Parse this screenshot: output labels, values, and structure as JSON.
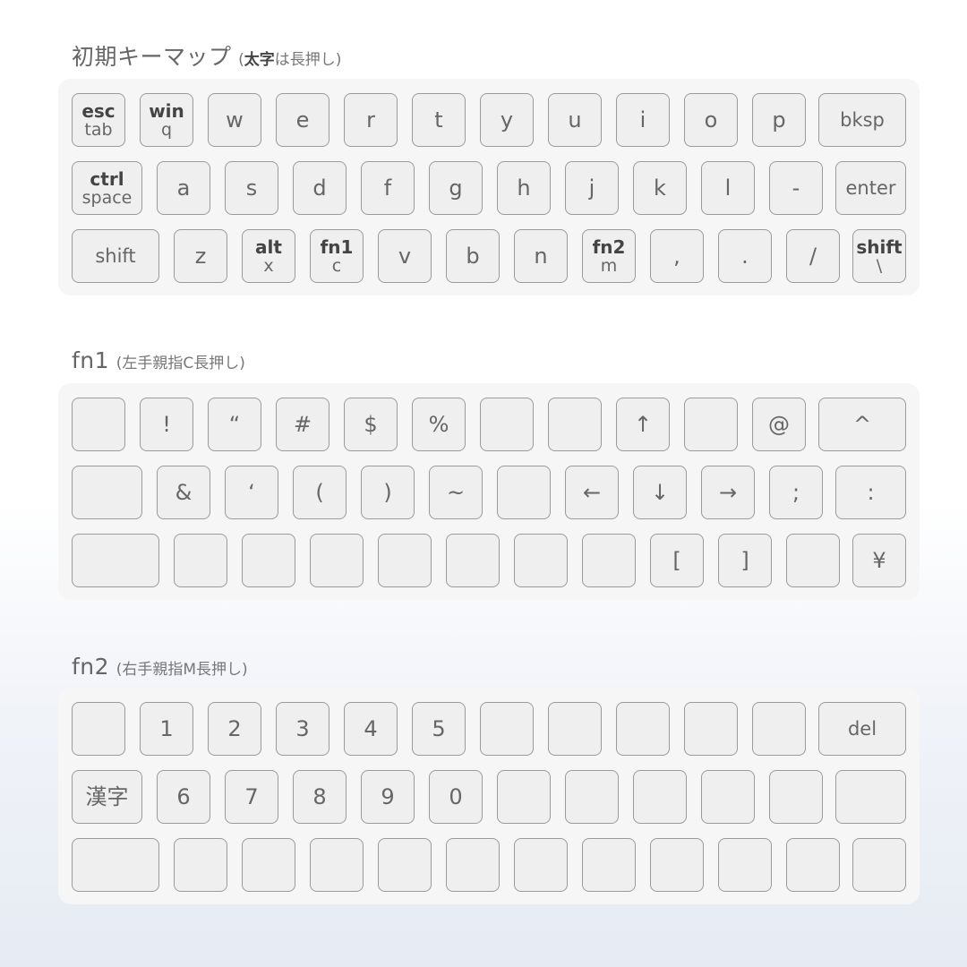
{
  "sections": [
    {
      "title": "初期キーマップ",
      "note_open": "(",
      "note_bold": "太字",
      "note_rest": "は長押し)",
      "rows": [
        [
          {
            "top": "esc",
            "bottom": "tab"
          },
          {
            "top": "win",
            "bottom": "q"
          },
          {
            "label": "w"
          },
          {
            "label": "e"
          },
          {
            "label": "r"
          },
          {
            "label": "t"
          },
          {
            "label": "y"
          },
          {
            "label": "u"
          },
          {
            "label": "i"
          },
          {
            "label": "o"
          },
          {
            "label": "p"
          },
          {
            "label": "bksp"
          }
        ],
        [
          {
            "top": "ctrl",
            "bottom": "space"
          },
          {
            "label": "a"
          },
          {
            "label": "s"
          },
          {
            "label": "d"
          },
          {
            "label": "f"
          },
          {
            "label": "g"
          },
          {
            "label": "h"
          },
          {
            "label": "j"
          },
          {
            "label": "k"
          },
          {
            "label": "l"
          },
          {
            "label": "-"
          },
          {
            "label": "enter"
          }
        ],
        [
          {
            "label": "shift"
          },
          {
            "label": "z"
          },
          {
            "top": "alt",
            "bottom": "x"
          },
          {
            "top": "fn1",
            "bottom": "c"
          },
          {
            "label": "v"
          },
          {
            "label": "b"
          },
          {
            "label": "n"
          },
          {
            "top": "fn2",
            "bottom": "m"
          },
          {
            "label": ","
          },
          {
            "label": "."
          },
          {
            "label": "/"
          },
          {
            "top": "shift",
            "bottom": "\\"
          }
        ]
      ]
    },
    {
      "title": "fn1",
      "note_open": "",
      "note_bold": "",
      "note_rest": "(左手親指C長押し)",
      "rows": [
        [
          {
            "label": ""
          },
          {
            "label": "!"
          },
          {
            "label": "“"
          },
          {
            "label": "#"
          },
          {
            "label": "$"
          },
          {
            "label": "%"
          },
          {
            "label": ""
          },
          {
            "label": ""
          },
          {
            "label": "↑"
          },
          {
            "label": ""
          },
          {
            "label": "@"
          },
          {
            "label": "^"
          }
        ],
        [
          {
            "label": ""
          },
          {
            "label": "&"
          },
          {
            "label": "‘"
          },
          {
            "label": "("
          },
          {
            "label": ")"
          },
          {
            "label": "~"
          },
          {
            "label": ""
          },
          {
            "label": "←"
          },
          {
            "label": "↓"
          },
          {
            "label": "→"
          },
          {
            "label": ";"
          },
          {
            "label": ":"
          }
        ],
        [
          {
            "label": ""
          },
          {
            "label": ""
          },
          {
            "label": ""
          },
          {
            "label": ""
          },
          {
            "label": ""
          },
          {
            "label": ""
          },
          {
            "label": ""
          },
          {
            "label": ""
          },
          {
            "label": "["
          },
          {
            "label": "]"
          },
          {
            "label": ""
          },
          {
            "label": "¥"
          }
        ]
      ]
    },
    {
      "title": "fn2",
      "note_open": "",
      "note_bold": "",
      "note_rest": "(右手親指M長押し)",
      "rows": [
        [
          {
            "label": ""
          },
          {
            "label": "1"
          },
          {
            "label": "2"
          },
          {
            "label": "3"
          },
          {
            "label": "4"
          },
          {
            "label": "5"
          },
          {
            "label": ""
          },
          {
            "label": ""
          },
          {
            "label": ""
          },
          {
            "label": ""
          },
          {
            "label": ""
          },
          {
            "label": "del"
          }
        ],
        [
          {
            "label": "漢字"
          },
          {
            "label": "6"
          },
          {
            "label": "7"
          },
          {
            "label": "8"
          },
          {
            "label": "9"
          },
          {
            "label": "0"
          },
          {
            "label": ""
          },
          {
            "label": ""
          },
          {
            "label": ""
          },
          {
            "label": ""
          },
          {
            "label": ""
          },
          {
            "label": ""
          }
        ],
        [
          {
            "label": ""
          },
          {
            "label": ""
          },
          {
            "label": ""
          },
          {
            "label": ""
          },
          {
            "label": ""
          },
          {
            "label": ""
          },
          {
            "label": ""
          },
          {
            "label": ""
          },
          {
            "label": ""
          },
          {
            "label": ""
          },
          {
            "label": ""
          },
          {
            "label": ""
          }
        ]
      ]
    }
  ]
}
